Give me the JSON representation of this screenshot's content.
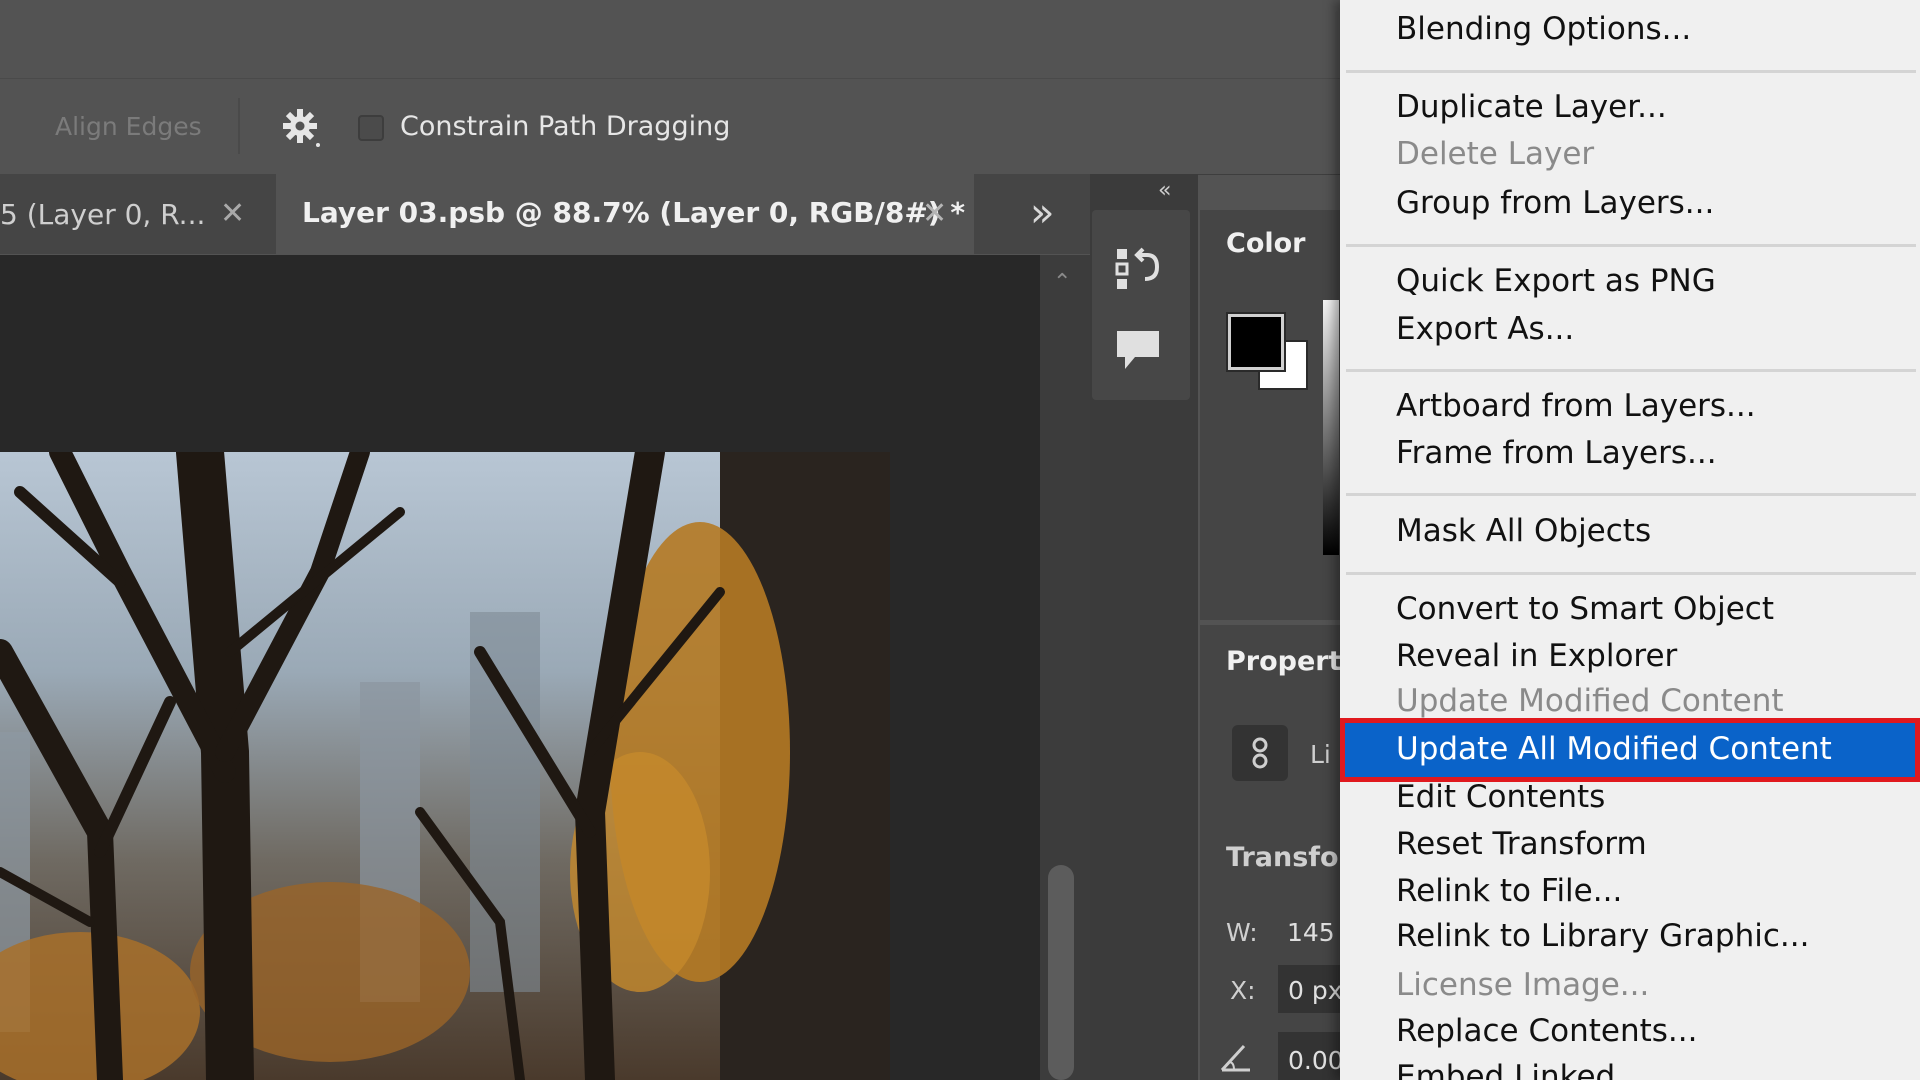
{
  "options_bar": {
    "align_edges_label": "Align Edges",
    "constrain_path_label": "Constrain Path Dragging",
    "icons": [
      "gear-icon"
    ]
  },
  "tabs": [
    {
      "label": "5 (Layer 0, R...",
      "active": false
    },
    {
      "label": "Layer 03.psb @ 88.7% (Layer 0, RGB/8#) *",
      "active": true
    }
  ],
  "overflow_label": "»",
  "panels": {
    "collapse_label": "«",
    "color_label": "Color",
    "properties_label": "Properti",
    "link_label": "Li",
    "transform_label": "Transfor",
    "w_label": "W:",
    "w_value": "145",
    "x_label": "X:",
    "x_value": "0 px",
    "angle_value": "0.00"
  },
  "context_menu": {
    "items": [
      {
        "label": "Blending Options...",
        "disabled": false
      },
      {
        "label": "Duplicate Layer...",
        "disabled": false
      },
      {
        "label": "Delete Layer",
        "disabled": true
      },
      {
        "label": "Group from Layers...",
        "disabled": false
      },
      {
        "label": "Quick Export as PNG",
        "disabled": false
      },
      {
        "label": "Export As...",
        "disabled": false
      },
      {
        "label": "Artboard from Layers...",
        "disabled": false
      },
      {
        "label": "Frame from Layers...",
        "disabled": false
      },
      {
        "label": "Mask All Objects",
        "disabled": false
      },
      {
        "label": "Convert to Smart Object",
        "disabled": false
      },
      {
        "label": "Reveal in Explorer",
        "disabled": false
      },
      {
        "label": "Update Modified Content",
        "disabled": true
      },
      {
        "label": "Update All Modified Content",
        "disabled": false,
        "highlighted": true
      },
      {
        "label": "Edit Contents",
        "disabled": false
      },
      {
        "label": "Reset Transform",
        "disabled": false
      },
      {
        "label": "Relink to File...",
        "disabled": false
      },
      {
        "label": "Relink to Library Graphic...",
        "disabled": false
      },
      {
        "label": "License Image...",
        "disabled": true
      },
      {
        "label": "Replace Contents...",
        "disabled": false
      },
      {
        "label": "Embed Linked",
        "disabled": false
      }
    ]
  },
  "colors": {
    "highlight_bg": "#0a63c9",
    "highlight_outline": "#e0191e",
    "menu_bg": "#f0f0f0",
    "ui_bg": "#535353"
  }
}
